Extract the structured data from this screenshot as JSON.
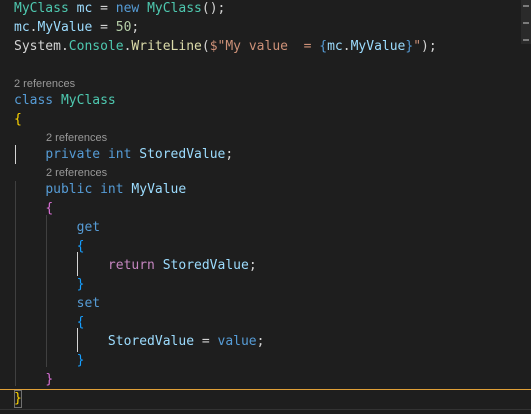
{
  "colors": {
    "background": "#1e1e1e",
    "type": "#4ec9b0",
    "variable": "#9cdcfe",
    "keyword": "#569cd6",
    "control_keyword": "#c586c0",
    "number": "#b5cea8",
    "string": "#ce9178",
    "plain": "#d4d4d4",
    "method": "#dcdcaa",
    "brace_level1": "#ffd700",
    "brace_level2": "#da70d6",
    "brace_level3": "#179fff",
    "codelens": "#999999",
    "selection_line": "#e0a038"
  },
  "codelens": {
    "class_refs": "2 references",
    "field_refs": "2 references",
    "property_refs": "2 references"
  },
  "lines": [
    {
      "name": "code-line-instantiation",
      "tokens": [
        {
          "t": "MyClass",
          "c": "type"
        },
        {
          "t": " ",
          "c": "plain"
        },
        {
          "t": "mc",
          "c": "variable"
        },
        {
          "t": " = ",
          "c": "plain"
        },
        {
          "t": "new",
          "c": "keyword"
        },
        {
          "t": " ",
          "c": "plain"
        },
        {
          "t": "MyClass",
          "c": "type"
        },
        {
          "t": "();",
          "c": "plain"
        }
      ]
    },
    {
      "name": "code-line-assignment",
      "tokens": [
        {
          "t": "mc",
          "c": "variable"
        },
        {
          "t": ".",
          "c": "plain"
        },
        {
          "t": "MyValue",
          "c": "variable"
        },
        {
          "t": " = ",
          "c": "plain"
        },
        {
          "t": "50",
          "c": "number"
        },
        {
          "t": ";",
          "c": "plain"
        }
      ]
    },
    {
      "name": "code-line-writeline",
      "tokens": [
        {
          "t": "System",
          "c": "plain"
        },
        {
          "t": ".",
          "c": "plain"
        },
        {
          "t": "Console",
          "c": "type"
        },
        {
          "t": ".",
          "c": "plain"
        },
        {
          "t": "WriteLine",
          "c": "method"
        },
        {
          "t": "(",
          "c": "plain"
        },
        {
          "t": "$\"My value  = ",
          "c": "string"
        },
        {
          "t": "{",
          "c": "keyword"
        },
        {
          "t": "mc",
          "c": "variable"
        },
        {
          "t": ".",
          "c": "plain"
        },
        {
          "t": "MyValue",
          "c": "variable"
        },
        {
          "t": "}",
          "c": "keyword"
        },
        {
          "t": "\"",
          "c": "string"
        },
        {
          "t": ");",
          "c": "plain"
        }
      ]
    },
    {
      "name": "code-line-class-decl",
      "tokens": [
        {
          "t": "class",
          "c": "keyword"
        },
        {
          "t": " ",
          "c": "plain"
        },
        {
          "t": "MyClass",
          "c": "type"
        }
      ]
    },
    {
      "name": "code-line-class-open-brace",
      "tokens": [
        {
          "t": "{",
          "c": "brace_level1"
        }
      ]
    },
    {
      "name": "code-line-field-decl",
      "tokens": [
        {
          "t": "    ",
          "c": "plain"
        },
        {
          "t": "private",
          "c": "keyword"
        },
        {
          "t": " ",
          "c": "plain"
        },
        {
          "t": "int",
          "c": "keyword"
        },
        {
          "t": " ",
          "c": "plain"
        },
        {
          "t": "StoredValue",
          "c": "variable"
        },
        {
          "t": ";",
          "c": "plain"
        }
      ]
    },
    {
      "name": "code-line-property-decl",
      "tokens": [
        {
          "t": "    ",
          "c": "plain"
        },
        {
          "t": "public",
          "c": "keyword"
        },
        {
          "t": " ",
          "c": "plain"
        },
        {
          "t": "int",
          "c": "keyword"
        },
        {
          "t": " ",
          "c": "plain"
        },
        {
          "t": "MyValue",
          "c": "variable"
        }
      ]
    },
    {
      "name": "code-line-property-open-brace",
      "tokens": [
        {
          "t": "    ",
          "c": "plain"
        },
        {
          "t": "{",
          "c": "brace_level2"
        }
      ]
    },
    {
      "name": "code-line-get",
      "tokens": [
        {
          "t": "        ",
          "c": "plain"
        },
        {
          "t": "get",
          "c": "keyword"
        }
      ]
    },
    {
      "name": "code-line-get-open-brace",
      "tokens": [
        {
          "t": "        ",
          "c": "plain"
        },
        {
          "t": "{",
          "c": "brace_level3"
        }
      ]
    },
    {
      "name": "code-line-return",
      "tokens": [
        {
          "t": "            ",
          "c": "plain"
        },
        {
          "t": "return",
          "c": "control_keyword"
        },
        {
          "t": " ",
          "c": "plain"
        },
        {
          "t": "StoredValue",
          "c": "variable"
        },
        {
          "t": ";",
          "c": "plain"
        }
      ]
    },
    {
      "name": "code-line-get-close-brace",
      "tokens": [
        {
          "t": "        ",
          "c": "plain"
        },
        {
          "t": "}",
          "c": "brace_level3"
        }
      ]
    },
    {
      "name": "code-line-set",
      "tokens": [
        {
          "t": "        ",
          "c": "plain"
        },
        {
          "t": "set",
          "c": "keyword"
        }
      ]
    },
    {
      "name": "code-line-set-open-brace",
      "tokens": [
        {
          "t": "        ",
          "c": "plain"
        },
        {
          "t": "{",
          "c": "brace_level3"
        }
      ]
    },
    {
      "name": "code-line-set-body",
      "tokens": [
        {
          "t": "            ",
          "c": "plain"
        },
        {
          "t": "StoredValue",
          "c": "variable"
        },
        {
          "t": " = ",
          "c": "plain"
        },
        {
          "t": "value",
          "c": "keyword"
        },
        {
          "t": ";",
          "c": "plain"
        }
      ]
    },
    {
      "name": "code-line-set-close-brace",
      "tokens": [
        {
          "t": "        ",
          "c": "plain"
        },
        {
          "t": "}",
          "c": "brace_level3"
        }
      ]
    },
    {
      "name": "code-line-property-close-brace",
      "tokens": [
        {
          "t": "    ",
          "c": "plain"
        },
        {
          "t": "}",
          "c": "brace_level2"
        }
      ]
    },
    {
      "name": "code-line-class-close-brace",
      "tokens": [
        {
          "t": "}",
          "c": "brace_level1"
        }
      ]
    }
  ]
}
